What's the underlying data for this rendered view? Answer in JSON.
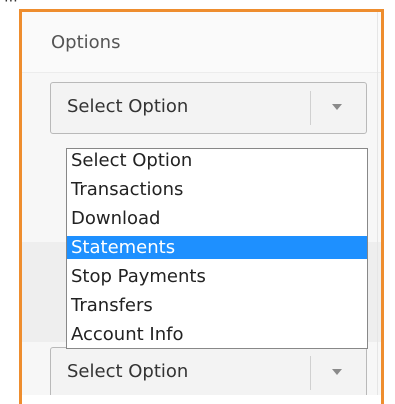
{
  "options_panel": {
    "title": "Options",
    "select_primary": {
      "value": "Select Option"
    },
    "select_secondary": {
      "value": "Select Option"
    }
  },
  "dropdown": {
    "items": [
      "Select Option",
      "Transactions",
      "Download",
      "Statements",
      "Stop Payments",
      "Transfers",
      "Account Info"
    ],
    "selected": "Statements"
  },
  "colors": {
    "frame": "#ee8d2e",
    "highlight": "#1e90ff"
  },
  "icons": {
    "select_caret": "caret-down-icon",
    "cropped_ellipsis": "ellipsis-icon"
  }
}
